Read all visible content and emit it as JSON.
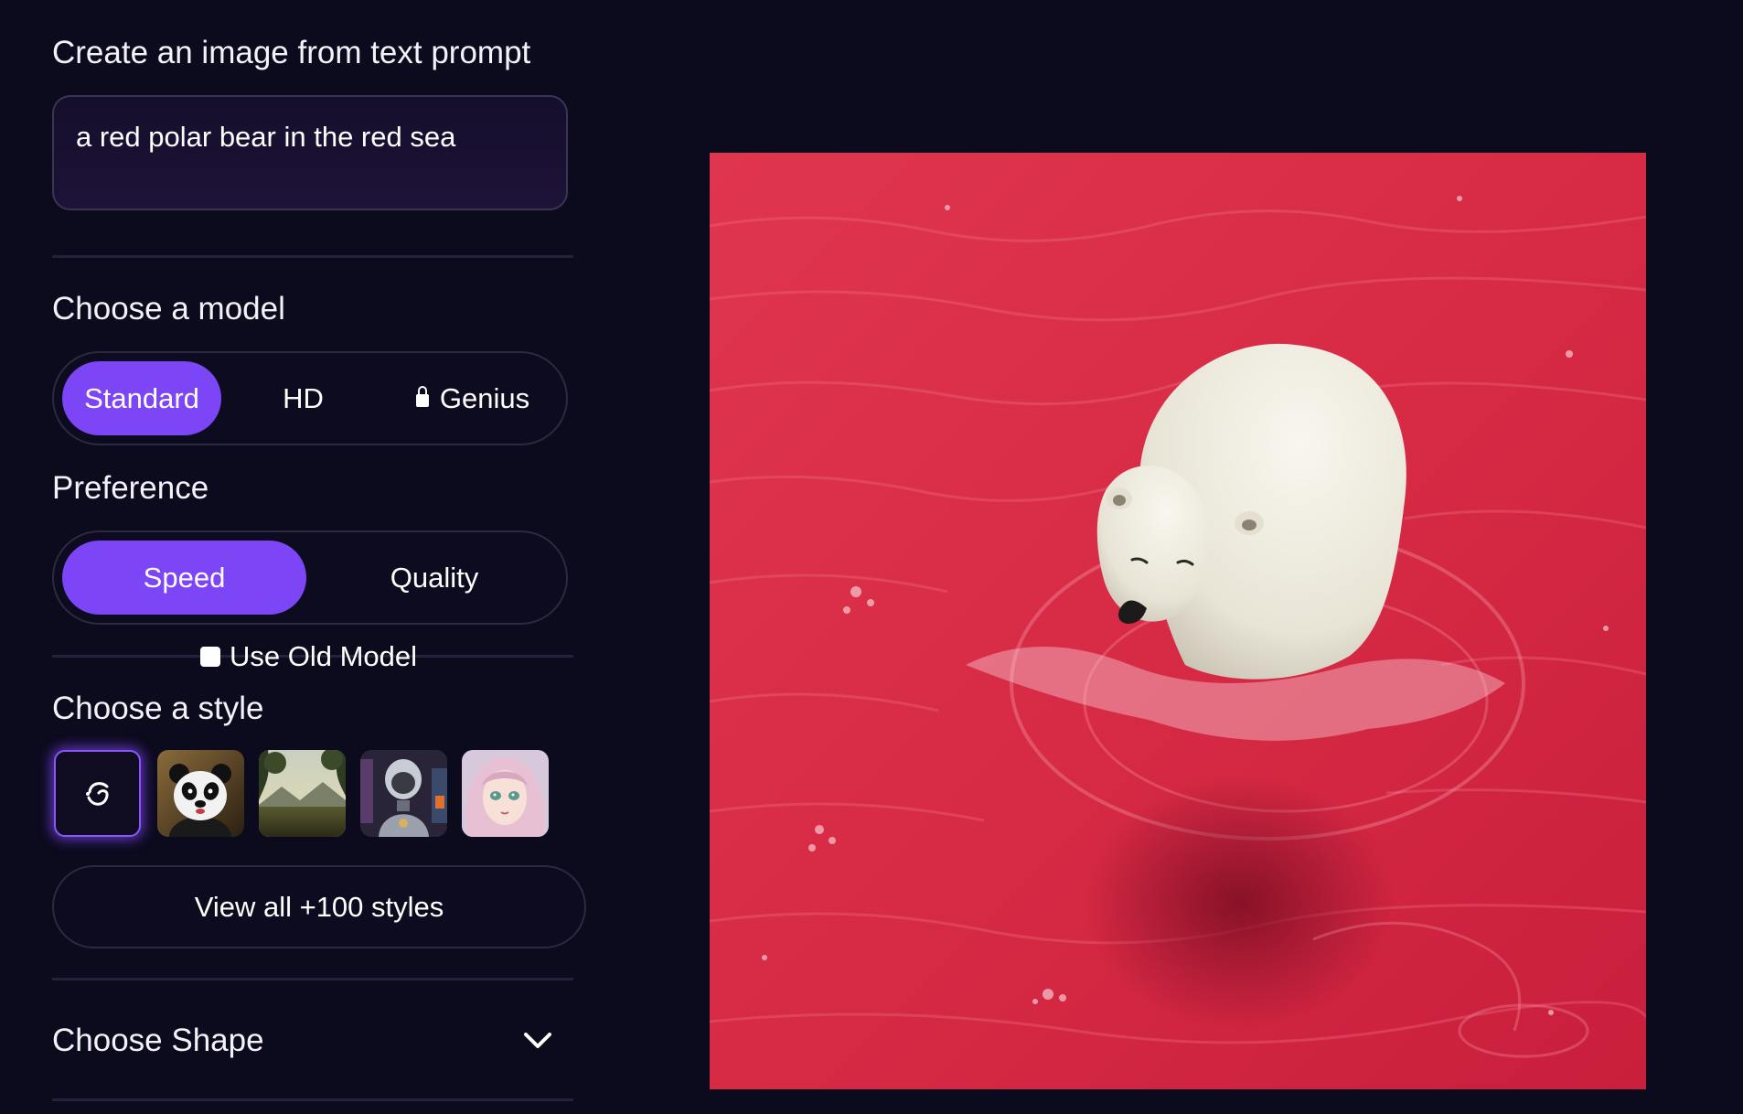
{
  "prompt": {
    "title": "Create an image from text prompt",
    "value": "a red polar bear in the red sea"
  },
  "model": {
    "title": "Choose a model",
    "options": [
      {
        "label": "Standard",
        "selected": true,
        "locked": false
      },
      {
        "label": "HD",
        "selected": false,
        "locked": false
      },
      {
        "label": "Genius",
        "selected": false,
        "locked": true
      }
    ]
  },
  "preference": {
    "title": "Preference",
    "options": [
      {
        "label": "Speed",
        "selected": true
      },
      {
        "label": "Quality",
        "selected": false
      }
    ]
  },
  "old_model": {
    "label": "Use Old Model",
    "checked": false
  },
  "style": {
    "title": "Choose a style",
    "thumbnails": [
      {
        "name": "no-style-icon",
        "selected": true
      },
      {
        "name": "panda",
        "selected": false
      },
      {
        "name": "landscape",
        "selected": false
      },
      {
        "name": "robot",
        "selected": false
      },
      {
        "name": "anime-girl",
        "selected": false
      }
    ],
    "view_all_label": "View all +100 styles"
  },
  "shape": {
    "title": "Choose Shape",
    "icon": "chevron-down-icon"
  },
  "colors": {
    "accent": "#7c45f5",
    "background": "#0c0a1d",
    "border": "#2c2940"
  },
  "result": {
    "subject": "polar bear in red water"
  }
}
